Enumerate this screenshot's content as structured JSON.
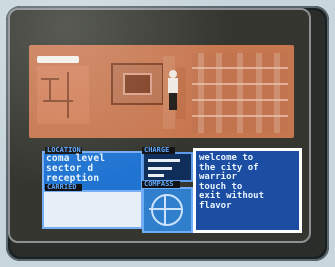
{
  "score": "",
  "panels": {
    "location_title": "LOCATION",
    "charge_title": "CHARGE",
    "carried_title": "CARRIED",
    "compass_title": "COMPASS"
  },
  "location_lines": [
    "coma level",
    "sector d",
    "reception"
  ],
  "message_lines": [
    "welcome to",
    "the city of",
    "warrior",
    "touch to",
    "exit without",
    "flavor"
  ],
  "colors": {
    "background": "#c7d6dc",
    "screen": "#34362f",
    "viewport": "#c7774f",
    "hud_blue": "#1f73d1",
    "message_blue": "#1b4da3"
  },
  "icons": {
    "compass": "compass-icon",
    "character": "character-sprite"
  }
}
